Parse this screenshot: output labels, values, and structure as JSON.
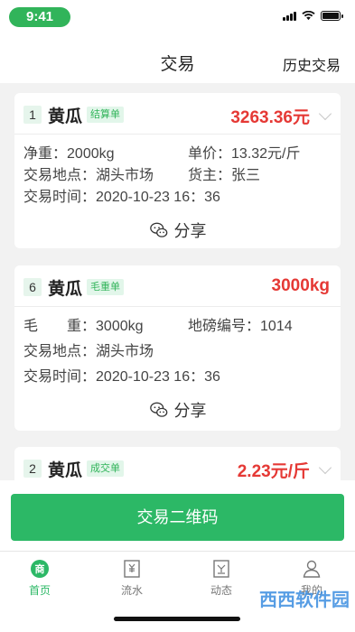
{
  "status": {
    "time": "9:41"
  },
  "nav": {
    "title": "交易",
    "history": "历史交易"
  },
  "cards": [
    {
      "num": "1",
      "name": "黄瓜",
      "tag": "结算单",
      "amount": "3263.36元",
      "rows": [
        {
          "k1": "净重：",
          "v1": "2000kg",
          "k2": "单价：",
          "v2": "13.32元/斤"
        },
        {
          "k1": "交易地点：",
          "v1": "湖头市场",
          "k2": "货主：",
          "v2": "张三"
        },
        {
          "k1": "交易时间：",
          "v1": "2020-10-23 16：36"
        }
      ],
      "share": "分享"
    },
    {
      "num": "6",
      "name": "黄瓜",
      "tag": "毛重单",
      "amount": "3000kg",
      "rows": [
        {
          "k1": "毛　　重：",
          "v1": "3000kg",
          "k2": "地磅编号：",
          "v2": "1014"
        },
        {
          "k1": "交易地点：",
          "v1": "湖头市场"
        },
        {
          "k1": "交易时间：",
          "v1": "2020-10-23 16：36"
        }
      ],
      "share": "分享"
    },
    {
      "num": "2",
      "name": "黄瓜",
      "tag": "成交单",
      "amount": "2.23元/斤"
    }
  ],
  "qr_button": "交易二维码",
  "tabs": [
    {
      "label": "首页",
      "icon": "home-icon"
    },
    {
      "label": "流水",
      "icon": "ledger-icon"
    },
    {
      "label": "动态",
      "icon": "news-icon"
    },
    {
      "label": "我的",
      "icon": "profile-icon"
    }
  ],
  "watermark": "西西软件园",
  "colors": {
    "accent": "#2cb866",
    "amount": "#e53935"
  }
}
